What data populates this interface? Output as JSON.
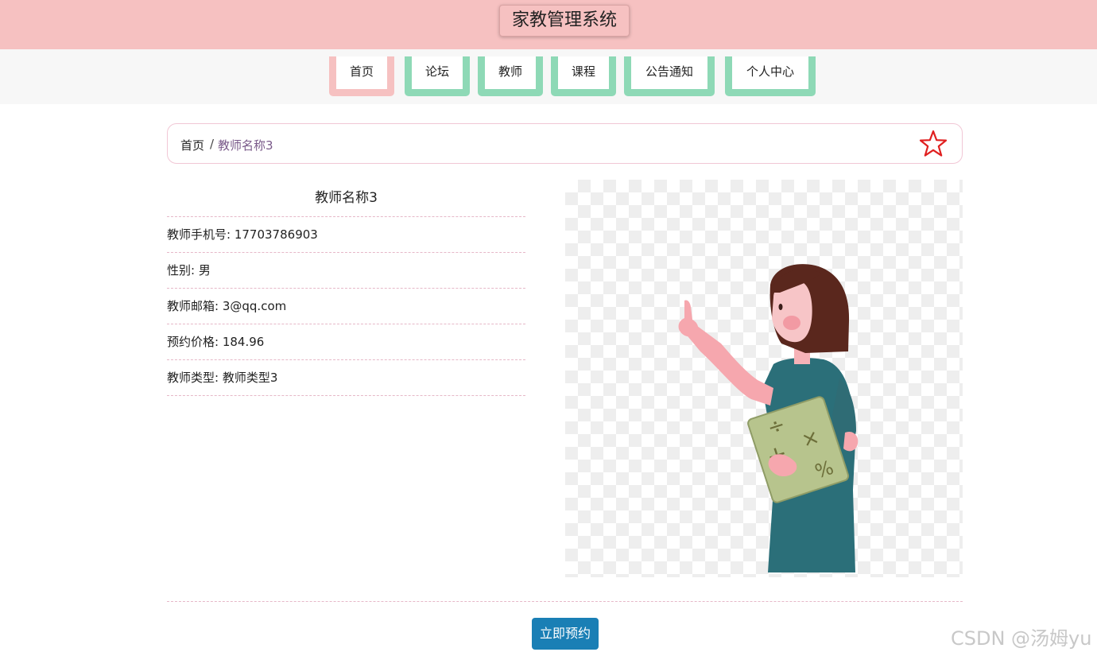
{
  "header": {
    "title": "家教管理系统"
  },
  "nav": {
    "items": [
      {
        "label": "首页"
      },
      {
        "label": "论坛"
      },
      {
        "label": "教师"
      },
      {
        "label": "课程"
      },
      {
        "label": "公告通知"
      },
      {
        "label": "个人中心"
      }
    ],
    "colors": {
      "active": "#f6c1c1",
      "inactive": "#8ed9b6"
    }
  },
  "breadcrumb": {
    "home": "首页",
    "separator": "/",
    "current": "教师名称3",
    "favorite_icon": "star-outline-icon"
  },
  "teacher": {
    "name": "教师名称3",
    "fields": [
      {
        "label": "教师手机号",
        "value": "17703786903"
      },
      {
        "label": "性别",
        "value": "男"
      },
      {
        "label": "教师邮箱",
        "value": "3@qq.com"
      },
      {
        "label": "预约价格",
        "value": "184.96"
      },
      {
        "label": "教师类型",
        "value": "教师类型3"
      }
    ],
    "photo_icon": "teacher-illustration",
    "board_symbols": [
      "÷",
      "+",
      "×",
      "%"
    ]
  },
  "actions": {
    "book_label": "立即预约"
  },
  "watermark": {
    "text": "CSDN @汤姆yu"
  },
  "colors": {
    "header_bg": "#f6c1c1",
    "button": "#1a7fb5",
    "star": "#e02020"
  }
}
